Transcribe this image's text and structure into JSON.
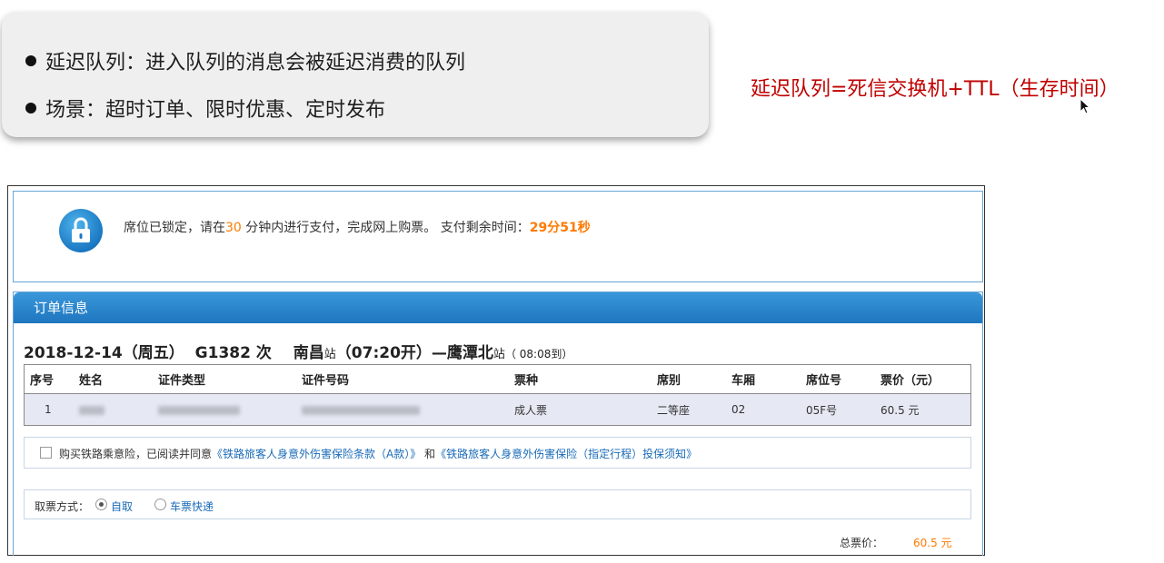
{
  "slide": {
    "bullets": [
      "延迟队列：进入队列的消息会被延迟消费的队列",
      "场景：超时订单、限时优惠、定时发布"
    ],
    "formula": "延迟队列=死信交换机+TTL（生存时间）"
  },
  "lock_notice": {
    "prefix": "席位已锁定，请在",
    "minutes": "30",
    "middle": " 分钟内进行支付，完成网上购票。 支付剩余时间：",
    "remaining": "29分51秒"
  },
  "order": {
    "header": "订单信息",
    "date": "2018-12-14（周五）",
    "train": "G1382 次",
    "from_station": "南昌",
    "station_suffix": "站",
    "depart_time": "（07:20开）—",
    "to_station": "鹰潭北",
    "arrival": "（ 08:08到）",
    "columns": [
      "序号",
      "姓名",
      "证件类型",
      "证件号码",
      "票种",
      "席别",
      "车厢",
      "席位号",
      "票价（元）"
    ],
    "rows": [
      {
        "index": "1",
        "ticket_type": "成人票",
        "seat_class": "二等座",
        "carriage": "02",
        "seat_no": "05F号",
        "price": "60.5 元"
      }
    ]
  },
  "insurance": {
    "prefix": "购买铁路乘意险，已阅读并同意",
    "link1": "《铁路旅客人身意外伤害保险条款（A款）》",
    "and": " 和",
    "link2": "《铁路旅客人身意外伤害保险（指定行程）投保须知》"
  },
  "pickup": {
    "label": "取票方式：",
    "options": [
      "自取",
      "车票快递"
    ],
    "selected": "自取"
  },
  "total": {
    "label": "总票价：",
    "value": "60.5 元"
  },
  "colors": {
    "accent_orange": "#ff7a00",
    "formula_red": "#c00000",
    "header_blue": "#2a86cc",
    "link_blue": "#1a6bb8"
  }
}
